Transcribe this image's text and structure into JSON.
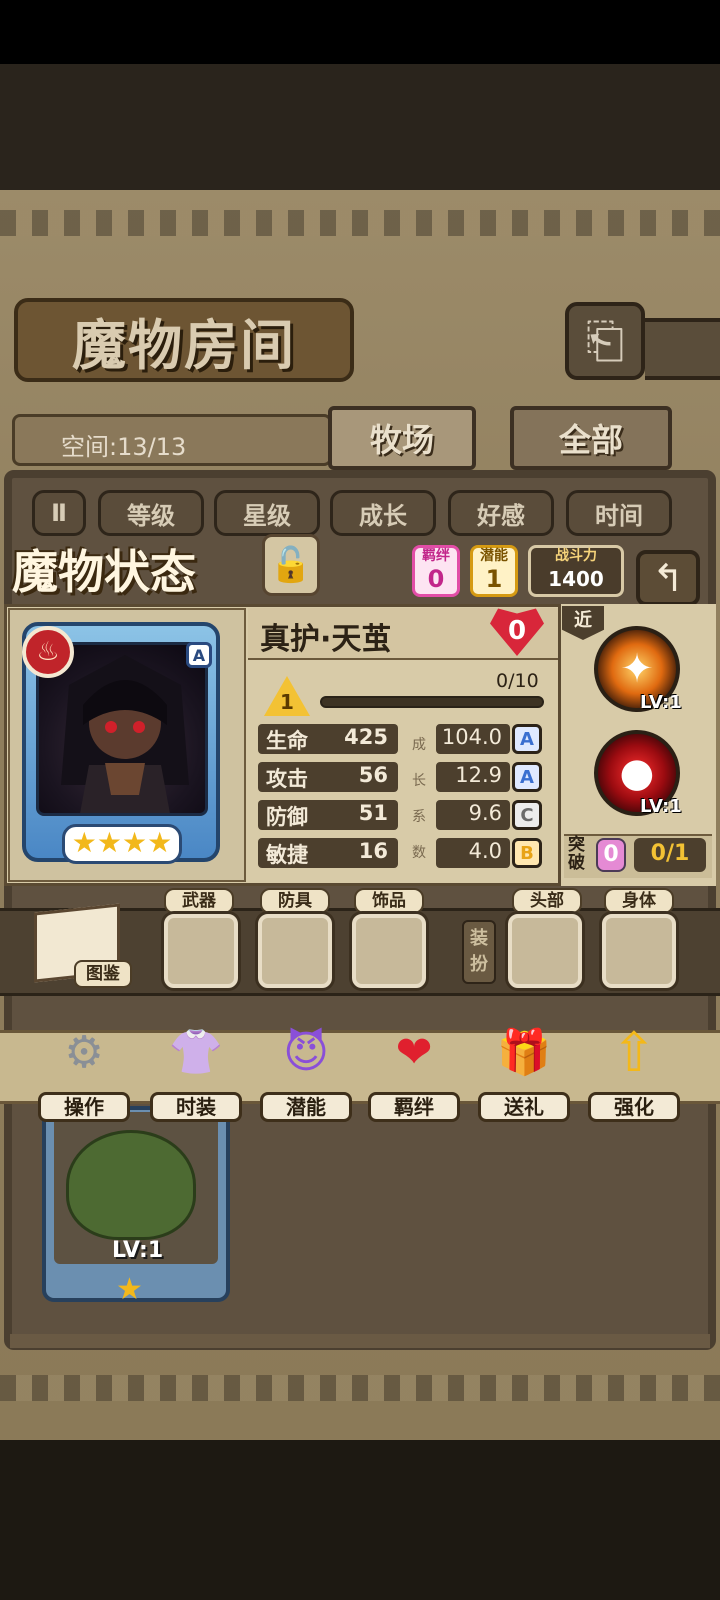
{
  "header": {
    "title": "魔物房间",
    "back_icon": "⎗"
  },
  "room": {
    "space_label": "空间:13/13"
  },
  "tabs": [
    {
      "label": "牧场",
      "active": true
    },
    {
      "label": "全部",
      "active": false
    }
  ],
  "sort_buttons": {
    "toggle": "Ⅱ",
    "items": [
      "等级",
      "星级",
      "成长",
      "好感",
      "时间"
    ]
  },
  "status": {
    "title": "魔物状态",
    "bond": {
      "label": "羁绊",
      "value": "0"
    },
    "potential": {
      "label": "潜能",
      "value": "1"
    },
    "power": {
      "label": "战斗力",
      "value": "1400"
    },
    "back_icon": "↰"
  },
  "monster": {
    "name": "真护·天茧",
    "rank": "A",
    "stars": "★★★★",
    "star_count": 4,
    "heart_value": "0",
    "level": "1",
    "exp_text": "0/10",
    "exp_fraction": 0.0,
    "stats": [
      {
        "label": "生命",
        "value": "425",
        "growth": "104.0",
        "grade": "A"
      },
      {
        "label": "攻击",
        "value": "56",
        "growth": "12.9",
        "grade": "A"
      },
      {
        "label": "防御",
        "value": "51",
        "growth": "9.6",
        "grade": "C"
      },
      {
        "label": "敏捷",
        "value": "16",
        "growth": "4.0",
        "grade": "B"
      }
    ],
    "growth_label_chars": [
      "成",
      "长",
      "系",
      "数"
    ]
  },
  "skills": {
    "range_tag": "近",
    "items": [
      {
        "lv": "LV:1",
        "icon": "✦"
      },
      {
        "lv": "LV:1",
        "icon": "●"
      }
    ],
    "break_label": "突破",
    "break_value": "0",
    "break_count": "0/1"
  },
  "equipment": {
    "book_label": "图鉴",
    "slots": [
      "武器",
      "防具",
      "饰品",
      "头部",
      "身体"
    ],
    "outfit_label": "装扮"
  },
  "actions": [
    {
      "label": "操作",
      "icon": "⚙"
    },
    {
      "label": "时装",
      "icon": "👚"
    },
    {
      "label": "潜能",
      "icon": "😈"
    },
    {
      "label": "羁绊",
      "icon": "❤"
    },
    {
      "label": "送礼",
      "icon": "🎁"
    },
    {
      "label": "强化",
      "icon": "⇧"
    }
  ],
  "card": {
    "lv": "LV:1",
    "star": "★"
  },
  "colors": {
    "grade_A": "#3a6fd0",
    "grade_B": "#e8a316",
    "grade_C": "#6b6b6b"
  }
}
